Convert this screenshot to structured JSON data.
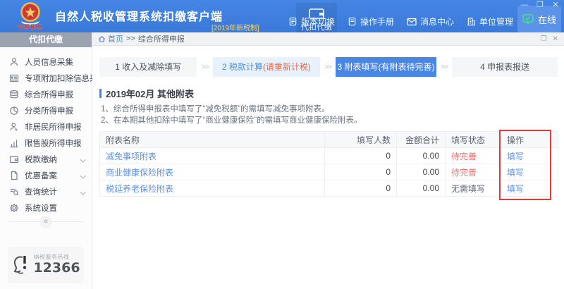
{
  "header": {
    "app_title": "自然人税收管理系统扣缴客户端",
    "app_subtitle": "[2019年新税制]",
    "module_tab": "代扣代缴",
    "menu_items": [
      "版本切换",
      "操作手册",
      "消息中心",
      "单位管理"
    ],
    "online_label": "在线",
    "window": {
      "minimize": "—",
      "restore": "❐",
      "close": "✕"
    },
    "emblem_text": "中国税务"
  },
  "sidebar": {
    "header": "代扣代缴",
    "items": [
      {
        "label": "人员信息采集"
      },
      {
        "label": "专项附加扣除信息采集"
      },
      {
        "label": "综合所得申报"
      },
      {
        "label": "分类所得申报"
      },
      {
        "label": "非居民所得申报"
      },
      {
        "label": "限售股所得申报"
      },
      {
        "label": "税款缴纳"
      },
      {
        "label": "优惠备案"
      },
      {
        "label": "查询统计"
      },
      {
        "label": "系统设置"
      }
    ],
    "collapse_label": "«",
    "hotline": {
      "label": "纳税服务热线",
      "number": "12366"
    }
  },
  "breadcrumb": {
    "home": "首页",
    "separator": ">>",
    "current": "综合所得申报"
  },
  "tab_controls": {
    "restore": "❐",
    "close": "✕"
  },
  "steps_separator": ">>",
  "steps": [
    {
      "label": "1 收入及减除填写",
      "note": ""
    },
    {
      "label": "2 税款计算",
      "note": "(请重新计税)"
    },
    {
      "label": "3 附表填写",
      "note": "(有附表待完善)"
    },
    {
      "label": "4 申报表报送",
      "note": ""
    }
  ],
  "content": {
    "period_title": "2019年02月 其他附表",
    "notes": [
      "1、综合所得申报表中填写了“减免税额”的需填写减免事项附表。",
      "2、在本期其他扣除中填写了“商业健康保险”的需填写商业健康保险附表。"
    ],
    "table": {
      "headers": [
        "附表名称",
        "填写人数",
        "金额合计",
        "填写状态",
        "操作"
      ],
      "rows": [
        {
          "name": "减免事项附表",
          "count": "0",
          "amount": "0.00",
          "status": "待完善",
          "status_class": "warn",
          "action": "填写"
        },
        {
          "name": "商业健康保险附表",
          "count": "0",
          "amount": "0.00",
          "status": "待完善",
          "status_class": "warn",
          "action": "填写"
        },
        {
          "name": "税延养老保险附表",
          "count": "0",
          "amount": "0.00",
          "status": "无需填写",
          "status_class": "plain",
          "action": "填写"
        }
      ]
    }
  },
  "colors": {
    "header_blue": "#3E7EDD",
    "accent_blue": "#4A86E4",
    "link_blue": "#5B8FE8",
    "warn_red": "#F56C6C",
    "highlight_red": "#E23B3B",
    "subtitle_yellow": "#FFD75E",
    "online_green": "#42C072"
  }
}
